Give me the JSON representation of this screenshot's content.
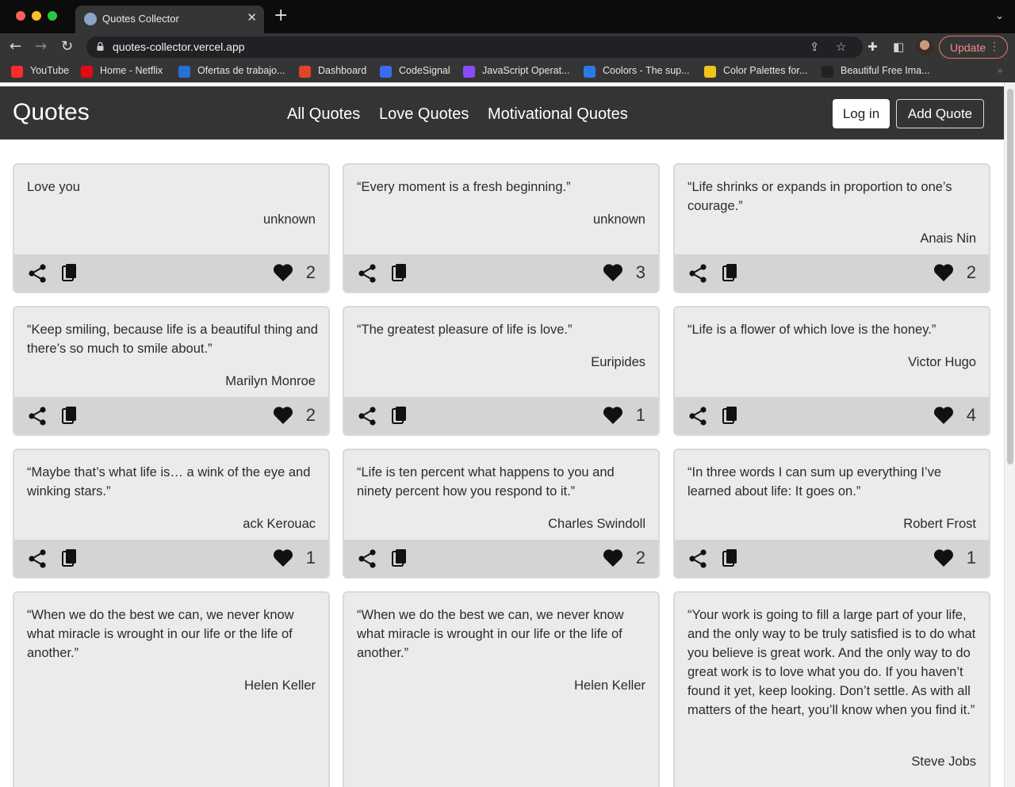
{
  "browser": {
    "tab_title": "Quotes Collector",
    "url": "quotes-collector.vercel.app",
    "update_label": "Update",
    "bookmarks": [
      "YouTube",
      "Home - Netflix",
      "Ofertas de trabajo...",
      "Dashboard",
      "CodeSignal",
      "JavaScript Operat...",
      "Coolors - The sup...",
      "Color Palettes for...",
      "Beautiful Free Ima..."
    ],
    "bookmark_colors": [
      "#ff2a2a",
      "#e50914",
      "#2a6fd6",
      "#e0452a",
      "#3a6cf4",
      "#8a4bff",
      "#2b7ae4",
      "#f0c419",
      "#222222"
    ]
  },
  "nav": {
    "brand": "Quotes",
    "links": [
      "All Quotes",
      "Love Quotes",
      "Motivational Quotes"
    ],
    "login_label": "Log in",
    "add_label": "Add Quote"
  },
  "quotes": [
    {
      "text": "Love you",
      "author": "unknown",
      "likes": "2"
    },
    {
      "text": "“Every moment is a fresh beginning.”",
      "author": "unknown",
      "likes": "3"
    },
    {
      "text": "“Life shrinks or expands in proportion to one’s courage.”",
      "author": "Anais Nin",
      "likes": "2"
    },
    {
      "text": "“Keep smiling, because life is a beautiful thing and there’s so much to smile about.”",
      "author": "Marilyn Monroe",
      "likes": "2"
    },
    {
      "text": "“The greatest pleasure of life is love.”",
      "author": "Euripides",
      "likes": "1"
    },
    {
      "text": "“Life is a flower of which love is the honey.”",
      "author": "Victor Hugo",
      "likes": "4"
    },
    {
      "text": "“Maybe that’s what life is… a wink of the eye and winking stars.”",
      "author": "ack Kerouac",
      "likes": "1"
    },
    {
      "text": "“Life is ten percent what happens to you and ninety percent how you respond to it.”",
      "author": "Charles Swindoll",
      "likes": "2"
    },
    {
      "text": "“In three words I can sum up everything I’ve learned about life: It goes on.”",
      "author": "Robert Frost",
      "likes": "1"
    },
    {
      "text": "“When we do the best we can, we never know what miracle is wrought in our life or the life of another.”",
      "author": "Helen Keller",
      "likes": ""
    },
    {
      "text": "“When we do the best we can, we never know what miracle is wrought in our life or the life of another.”",
      "author": "Helen Keller",
      "likes": ""
    },
    {
      "text": "“Your work is going to fill a large part of your life, and the only way to be truly satisfied is to do what you believe is great work. And the only way to do great work is to love what you do. If you haven’t found it yet, keep looking. Don’t settle. As with all matters of the heart, you’ll know when you find it.”",
      "author": "Steve Jobs",
      "likes": ""
    }
  ]
}
